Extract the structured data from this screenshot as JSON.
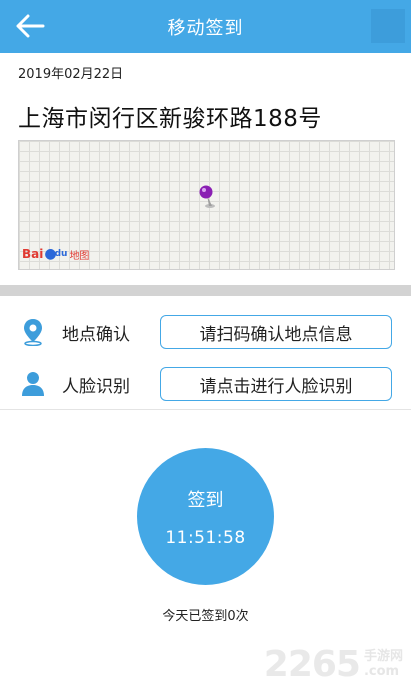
{
  "header": {
    "title": "移动签到",
    "back_icon": "arrow-left-icon"
  },
  "info": {
    "date": "2019年02月22日",
    "address": "上海市闵行区新骏环路188号"
  },
  "map": {
    "logo_text": "Bai",
    "logo_suffix": "du",
    "logo_map_text": "地图",
    "pin_color": "#8a1fb3"
  },
  "location_row": {
    "icon": "location-pin-icon",
    "label": "地点确认",
    "button_label": "请扫码确认地点信息"
  },
  "face_row": {
    "icon": "person-icon",
    "label": "人脸识别",
    "button_label": "请点击进行人脸识别"
  },
  "signin": {
    "label": "签到",
    "time": "11:51:58",
    "count_text": "今天已签到0次"
  },
  "watermark": {
    "main": "2265",
    "sub": "手游网",
    "sub2": ".com"
  },
  "colors": {
    "accent": "#44a8e6",
    "icon_blue": "#3d9ddb"
  }
}
